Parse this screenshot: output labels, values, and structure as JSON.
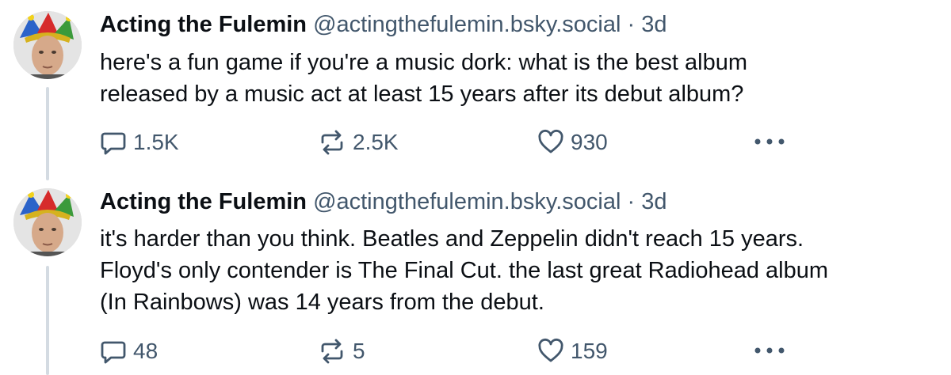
{
  "posts": [
    {
      "author": "Acting the Fulemin",
      "handle": "@actingthefulemin.bsky.social",
      "separator": "·",
      "time": "3d",
      "lines": [
        "here's a fun game if you're a music dork: what is the best album",
        "released by a music act at least 15 years after its debut album?"
      ],
      "replies": "1.5K",
      "reposts": "2.5K",
      "likes": "930"
    },
    {
      "author": "Acting the Fulemin",
      "handle": "@actingthefulemin.bsky.social",
      "separator": "·",
      "time": "3d",
      "lines": [
        "it's harder than you think. Beatles and Zeppelin didn't reach 15 years.",
        "Floyd's only contender is The Final Cut. the last great Radiohead album",
        "(In Rainbows) was 14 years from the debut."
      ],
      "replies": "48",
      "reposts": "5",
      "likes": "159"
    }
  ],
  "icons": {
    "reply": "reply-icon",
    "repost": "repost-icon",
    "like": "heart-icon",
    "more": "more-options-icon"
  },
  "colors": {
    "text": "#0b0f14",
    "muted": "#42576c",
    "thread_line": "#d4dbe2"
  }
}
